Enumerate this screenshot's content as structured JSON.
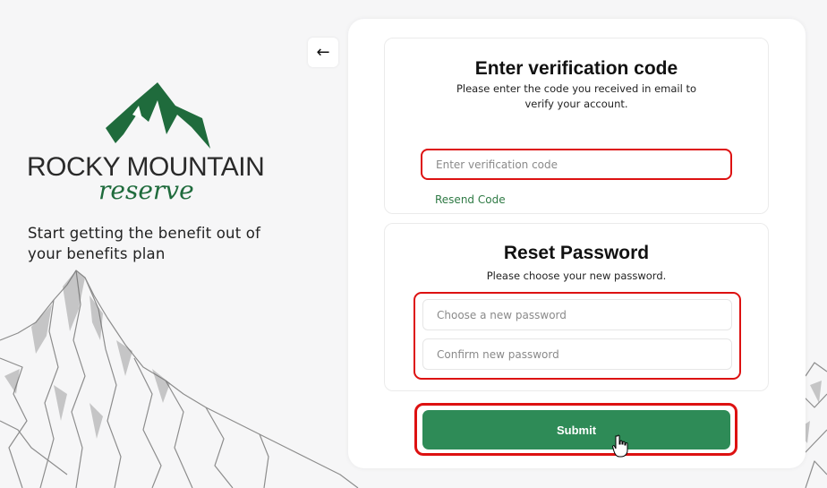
{
  "brand": {
    "name_line1": "ROCKY MOUNTAIN",
    "name_line2": "reserve",
    "colors": {
      "green": "#2e7d4a",
      "dark_green": "#1f6b3c"
    }
  },
  "tagline": "Start getting the benefit out of your benefits plan",
  "back_button": {
    "icon": "arrow-left-icon",
    "glyph": "←"
  },
  "verification": {
    "title": "Enter verification code",
    "description": "Please enter the code you received in email to verify your account.",
    "code_input": {
      "placeholder": "Enter verification code",
      "value": ""
    },
    "resend_label": "Resend Code"
  },
  "reset": {
    "title": "Reset Password",
    "description": "Please choose your new password.",
    "new_password": {
      "placeholder": "Choose a new password",
      "value": ""
    },
    "confirm_password": {
      "placeholder": "Confirm new password",
      "value": ""
    }
  },
  "submit_label": "Submit",
  "colors": {
    "accent": "#2e8b57",
    "highlight": "#dd1111",
    "background": "#f6f6f7"
  }
}
